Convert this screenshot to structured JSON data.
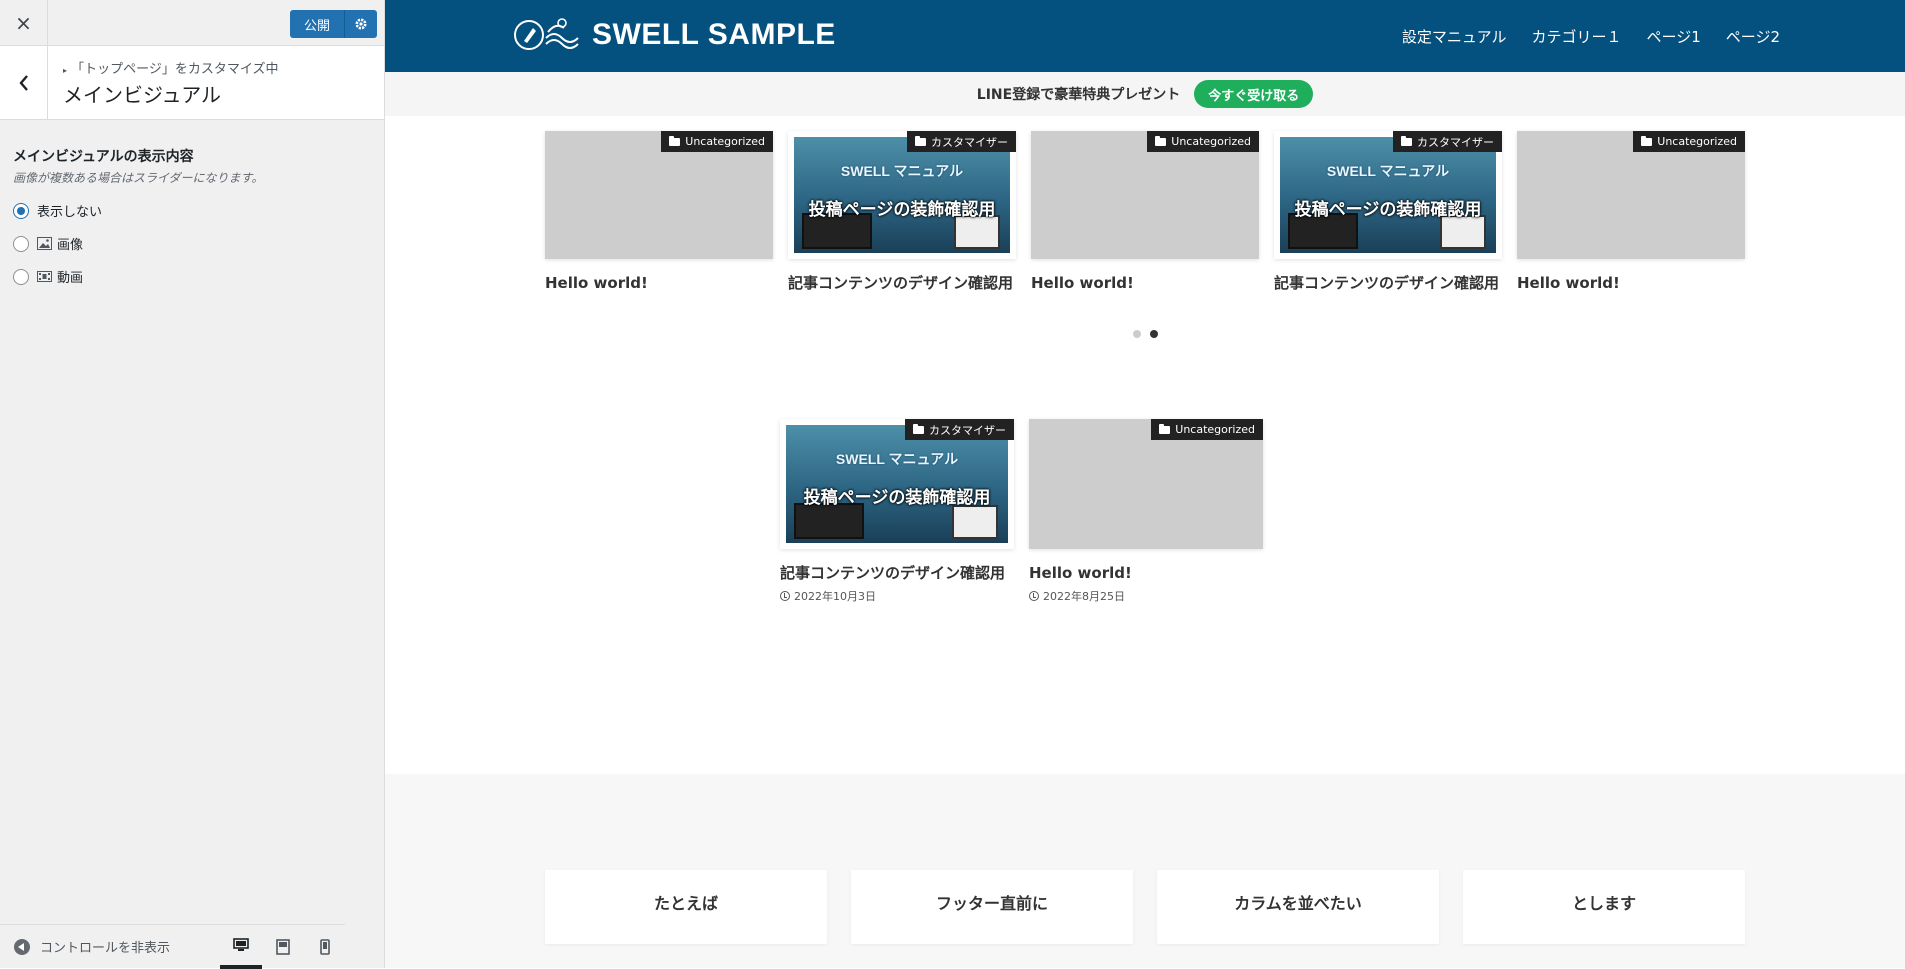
{
  "customizer": {
    "close_label": "×",
    "publish_label": "公開",
    "section_crumb": "「トップページ」をカスタマイズ中",
    "section_title": "メインビジュアル",
    "control_title": "メインビジュアルの表示内容",
    "control_desc": "画像が複数ある場合はスライダーになります。",
    "options": [
      {
        "label": "表示しない",
        "checked": true
      },
      {
        "label": "画像",
        "checked": false
      },
      {
        "label": "動画",
        "checked": false
      }
    ],
    "hide_controls_label": "コントロールを非表示",
    "active_device": "desktop"
  },
  "site": {
    "logo_text": "SWELL SAMPLE",
    "header_color": "#04507e",
    "nav": [
      "設定マニュアル",
      "カテゴリー１",
      "ページ1",
      "ページ2"
    ],
    "notice_text": "LINE登録で豪華特典プレゼント",
    "notice_button": "今すぐ受け取る",
    "notice_button_color": "#1fae5c"
  },
  "slider_posts": [
    {
      "title": "Hello world!",
      "category": "Uncategorized",
      "thumbnail": "placeholder"
    },
    {
      "title": "記事コンテンツのデザイン確認用",
      "category": "カスタマイザー",
      "thumbnail": "manual"
    },
    {
      "title": "Hello world!",
      "category": "Uncategorized",
      "thumbnail": "placeholder"
    },
    {
      "title": "記事コンテンツのデザイン確認用",
      "category": "カスタマイザー",
      "thumbnail": "manual"
    },
    {
      "title": "Hello world!",
      "category": "Uncategorized",
      "thumbnail": "placeholder"
    }
  ],
  "slider_pagination": {
    "pages": 2,
    "active": 2
  },
  "manual_image": {
    "top_text": "SWELL マニュアル",
    "main_text": "投稿ページの装飾確認用"
  },
  "list_posts": [
    {
      "title": "記事コンテンツのデザイン確認用",
      "category": "カスタマイザー",
      "date": "2022年10月3日",
      "thumbnail": "manual"
    },
    {
      "title": "Hello world!",
      "category": "Uncategorized",
      "date": "2022年8月25日",
      "thumbnail": "placeholder"
    }
  ],
  "footer_widgets": [
    "たとえば",
    "フッター直前に",
    "カラムを並べたい",
    "とします"
  ]
}
